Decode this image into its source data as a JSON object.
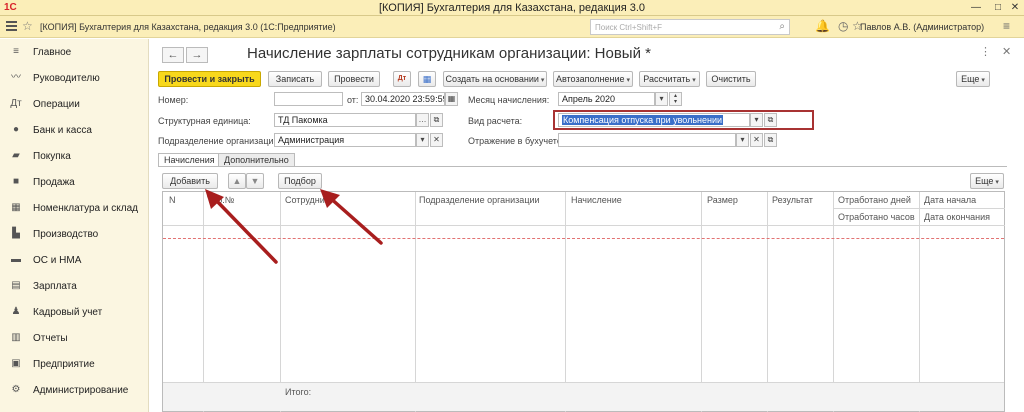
{
  "window": {
    "logo": "1С",
    "title": "[КОПИЯ] Бухгалтерия для Казахстана, редакция 3.0"
  },
  "appbar": {
    "title": "[КОПИЯ] Бухгалтерия для Казахстана, редакция 3.0  (1С:Предприятие)",
    "search_placeholder": "Поиск Ctrl+Shift+F",
    "user": "Павлов А.В. (Администратор)"
  },
  "sidebar": {
    "items": [
      {
        "label": "Главное",
        "icon": "list-icon"
      },
      {
        "label": "Руководителю",
        "icon": "chart-line-icon"
      },
      {
        "label": "Операции",
        "icon": "operations-icon"
      },
      {
        "label": "Банк и касса",
        "icon": "bank-icon"
      },
      {
        "label": "Покупка",
        "icon": "cart-icon"
      },
      {
        "label": "Продажа",
        "icon": "bag-icon"
      },
      {
        "label": "Номенклатура и склад",
        "icon": "warehouse-icon"
      },
      {
        "label": "Производство",
        "icon": "factory-icon"
      },
      {
        "label": "ОС и НМА",
        "icon": "truck-icon"
      },
      {
        "label": "Зарплата",
        "icon": "salary-icon"
      },
      {
        "label": "Кадровый учет",
        "icon": "people-icon"
      },
      {
        "label": "Отчеты",
        "icon": "report-icon"
      },
      {
        "label": "Предприятие",
        "icon": "enterprise-icon"
      },
      {
        "label": "Администрирование",
        "icon": "gear-icon"
      }
    ]
  },
  "document": {
    "title": "Начисление зарплаты сотрудникам организации: Новый *"
  },
  "toolbar": {
    "post_close": "Провести и закрыть",
    "save": "Записать",
    "post": "Провести",
    "create_based": "Создать на основании",
    "autofill": "Автозаполнение",
    "calculate": "Рассчитать",
    "clear": "Очистить",
    "more": "Еще"
  },
  "form": {
    "number_label": "Номер:",
    "number_value": "",
    "date_label": "от:",
    "date_value": "30.04.2020 23:59:59",
    "month_label": "Месяц начисления:",
    "month_value": "Апрель 2020",
    "unit_label": "Структурная единица:",
    "unit_value": "ТД Пакомка",
    "calc_type_label": "Вид расчета:",
    "calc_type_value": "Компенсация отпуска при увольнении",
    "department_label": "Подразделение организации:",
    "department_value": "Администрация",
    "accounting_label": "Отражение в бухучете:",
    "accounting_value": ""
  },
  "tabs": [
    {
      "label": "Начисления",
      "active": true
    },
    {
      "label": "Дополнительно",
      "active": false
    }
  ],
  "table_toolbar": {
    "add": "Добавить",
    "pick": "Подбор",
    "more": "Еще"
  },
  "table": {
    "columns": [
      "N",
      "Таб.№",
      "Сотрудник",
      "Подразделение организации",
      "Начисление",
      "Размер",
      "Результат",
      "Отработано дней",
      "Отработано часов",
      "Дата начала",
      "Дата окончания"
    ],
    "footer_total": "Итого:"
  },
  "colors": {
    "header_bg": "#fbeeb8",
    "sidebar_bg": "#fbf6e1",
    "primary_button": "#f8d81c",
    "annotation_red": "#a81e1e",
    "highlight_border": "#a83232"
  }
}
